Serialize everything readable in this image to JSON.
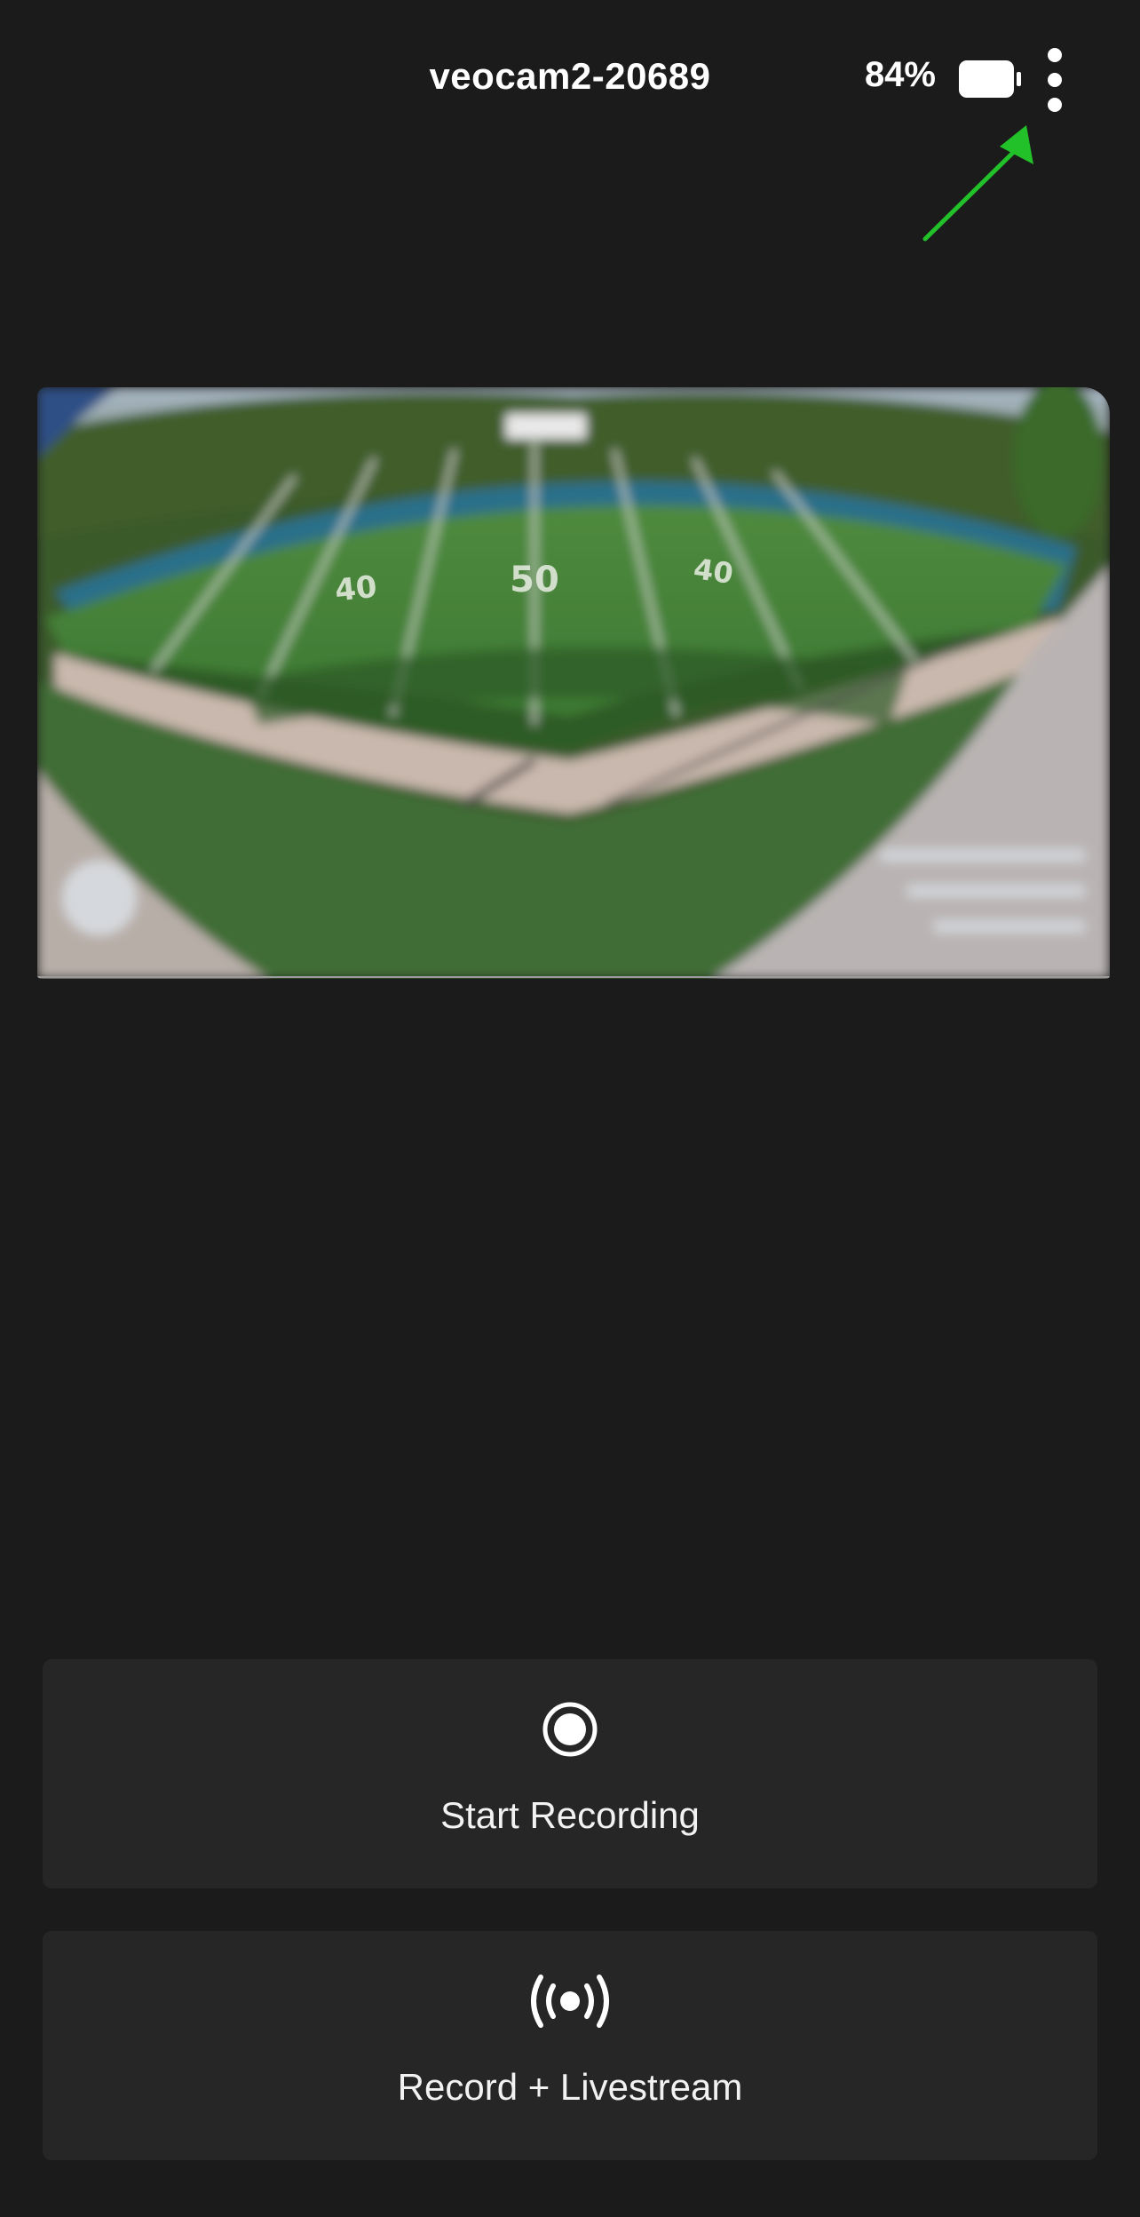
{
  "header": {
    "device_name": "veocam2-20689",
    "battery_percent": "84%",
    "battery_level": 0.84,
    "menu_icon": "more-vertical-icon",
    "battery_icon": "battery-icon"
  },
  "annotation": {
    "arrow_color": "#22c12a",
    "points_to": "menu-button"
  },
  "preview": {
    "description_icon": "camera-preview-image",
    "field_numbers": [
      "50",
      "40",
      "40"
    ]
  },
  "actions": {
    "start_recording": {
      "label": "Start Recording",
      "icon": "record-icon"
    },
    "record_livestream": {
      "label": "Record + Livestream",
      "icon": "broadcast-icon"
    }
  },
  "colors": {
    "background": "#1b1b1b",
    "button_background": "#262626",
    "text": "#ffffff"
  }
}
